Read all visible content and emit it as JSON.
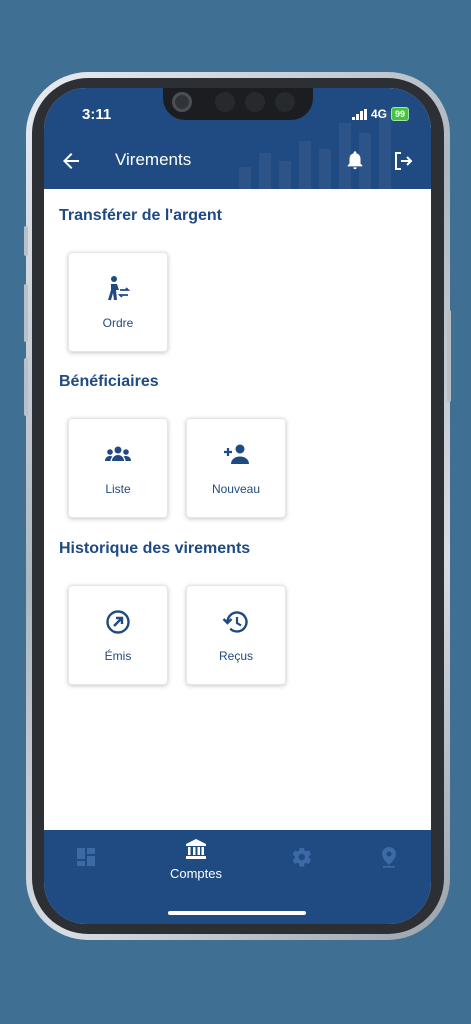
{
  "status": {
    "time": "3:11",
    "network": "4G",
    "battery": "99"
  },
  "header": {
    "title": "Virements"
  },
  "sections": {
    "transfer": {
      "title": "Transférer de l'argent",
      "tiles": [
        {
          "label": "Ordre",
          "icon": "person-transfer-icon"
        }
      ]
    },
    "beneficiaries": {
      "title": "Bénéficiaires",
      "tiles": [
        {
          "label": "Liste",
          "icon": "group-icon"
        },
        {
          "label": "Nouveau",
          "icon": "add-person-icon"
        }
      ]
    },
    "history": {
      "title": "Historique des virements",
      "tiles": [
        {
          "label": "Émis",
          "icon": "sent-arrow-icon"
        },
        {
          "label": "Reçus",
          "icon": "history-icon"
        }
      ]
    }
  },
  "bottom_nav": {
    "items": [
      {
        "icon": "dashboard-icon"
      },
      {
        "icon": "bank-icon",
        "label": "Comptes",
        "active": true
      },
      {
        "icon": "gear-icon"
      },
      {
        "icon": "location-pin-icon"
      }
    ]
  },
  "colors": {
    "primary": "#1f4a82",
    "background": "#3f6f93",
    "inactive_icon": "#3d6aa5",
    "battery": "#44c43f"
  }
}
